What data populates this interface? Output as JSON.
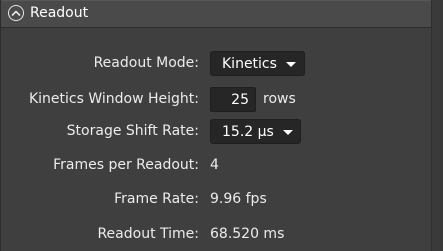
{
  "header": {
    "title": "Readout"
  },
  "fields": {
    "readout_mode": {
      "label": "Readout Mode:",
      "value": "Kinetics"
    },
    "kinetics_window_height": {
      "label": "Kinetics Window Height:",
      "value": "25",
      "unit": "rows"
    },
    "storage_shift_rate": {
      "label": "Storage Shift Rate:",
      "value": "15.2 µs"
    },
    "frames_per_readout": {
      "label": "Frames per Readout:",
      "value": "4"
    },
    "frame_rate": {
      "label": "Frame Rate:",
      "value": "9.96 fps"
    },
    "readout_time": {
      "label": "Readout Time:",
      "value": "68.520 ms"
    }
  },
  "icons": {
    "collapse": "chevron-up-icon",
    "dropdown": "caret-down-icon"
  },
  "colors": {
    "panel_bg": "#3f3f3f",
    "header_bg": "#4a4a4a",
    "control_bg": "#262626",
    "text": "#ffffff"
  }
}
